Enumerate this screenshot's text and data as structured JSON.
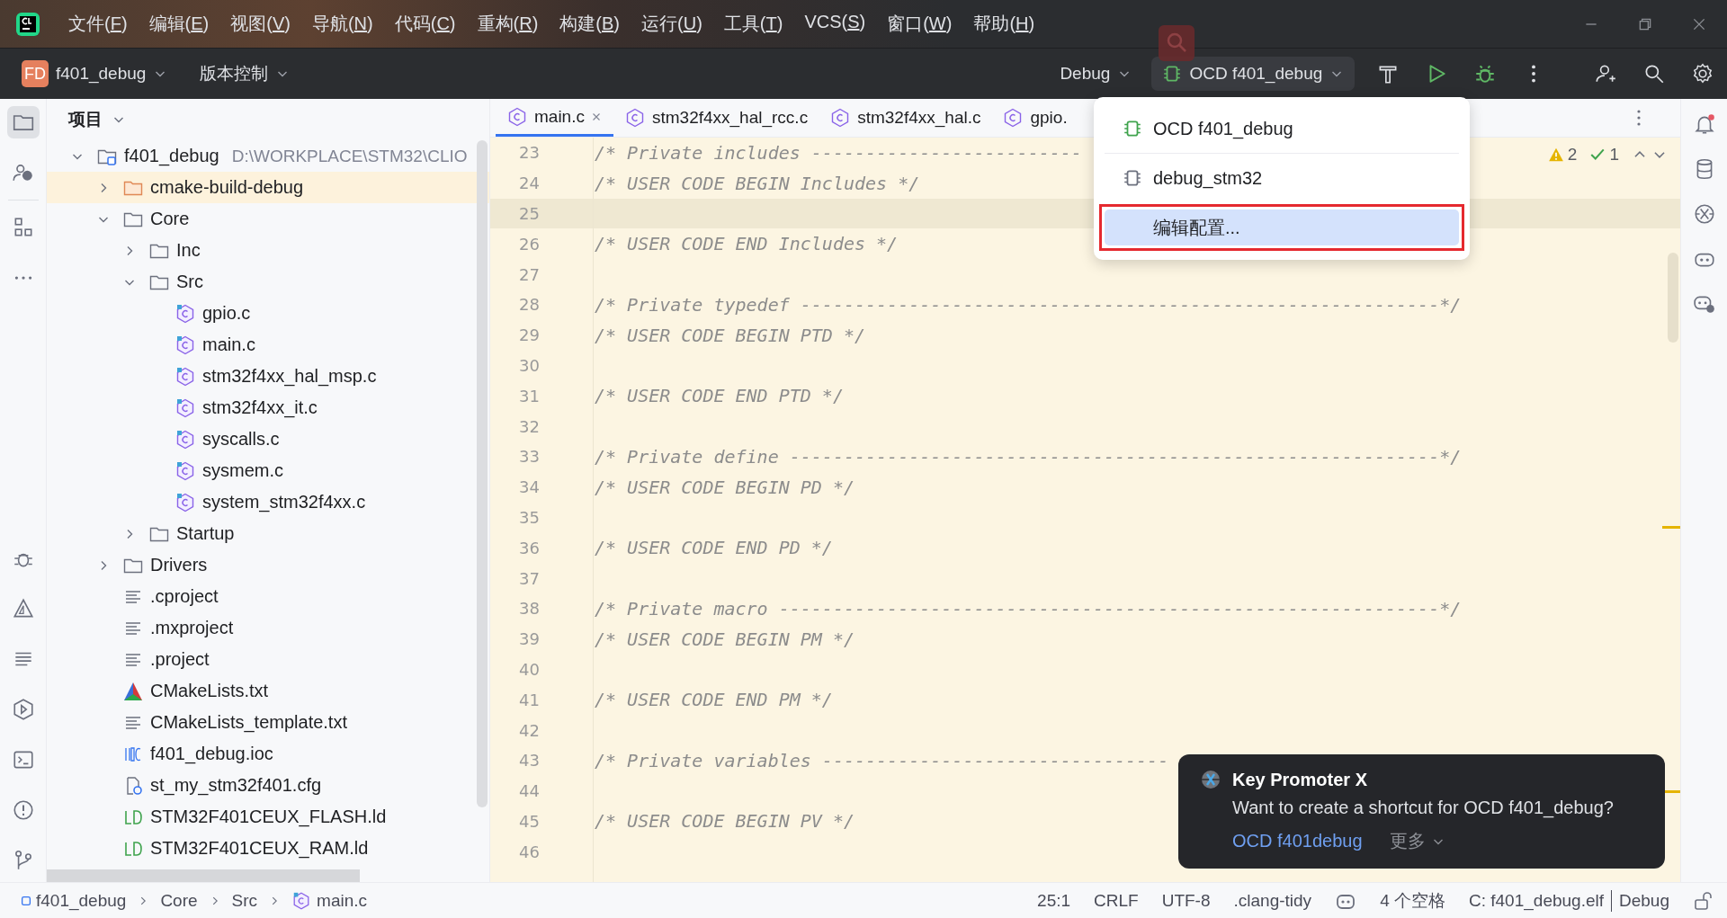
{
  "menu": [
    "文件(F)",
    "编辑(E)",
    "视图(V)",
    "导航(N)",
    "代码(C)",
    "重构(R)",
    "构建(B)",
    "运行(U)",
    "工具(T)",
    "VCS(S)",
    "窗口(W)",
    "帮助(H)"
  ],
  "toolbar": {
    "project_badge": "FD",
    "project": "f401_debug",
    "vcs": "版本控制",
    "build_type": "Debug",
    "run_config": "OCD f401_debug"
  },
  "project_panel": {
    "title": "项目"
  },
  "tree": [
    {
      "name": "f401_debug",
      "path": "D:\\WORKPLACE\\STM32\\CLIO",
      "kind": "module",
      "expanded": true,
      "children": [
        {
          "name": "cmake-build-debug",
          "kind": "folder",
          "expanded": false,
          "excluded": true
        },
        {
          "name": "Core",
          "kind": "folder",
          "expanded": true,
          "excluded": false,
          "children": [
            {
              "name": "Inc",
              "kind": "folder",
              "expanded": false,
              "excluded": false
            },
            {
              "name": "Src",
              "kind": "folder",
              "expanded": true,
              "excluded": false,
              "children": [
                {
                  "name": "gpio.c",
                  "kind": "c"
                },
                {
                  "name": "main.c",
                  "kind": "c"
                },
                {
                  "name": "stm32f4xx_hal_msp.c",
                  "kind": "c"
                },
                {
                  "name": "stm32f4xx_it.c",
                  "kind": "c"
                },
                {
                  "name": "syscalls.c",
                  "kind": "c"
                },
                {
                  "name": "sysmem.c",
                  "kind": "c"
                },
                {
                  "name": "system_stm32f4xx.c",
                  "kind": "c"
                }
              ]
            },
            {
              "name": "Startup",
              "kind": "folder",
              "expanded": false,
              "excluded": false
            }
          ]
        },
        {
          "name": "Drivers",
          "kind": "folder",
          "expanded": false,
          "excluded": false
        },
        {
          "name": ".cproject",
          "kind": "text"
        },
        {
          "name": ".mxproject",
          "kind": "text"
        },
        {
          "name": ".project",
          "kind": "text"
        },
        {
          "name": "CMakeLists.txt",
          "kind": "cmake"
        },
        {
          "name": "CMakeLists_template.txt",
          "kind": "text"
        },
        {
          "name": "f401_debug.ioc",
          "kind": "ioc"
        },
        {
          "name": "st_my_stm32f401.cfg",
          "kind": "cfg"
        },
        {
          "name": "STM32F401CEUX_FLASH.ld",
          "kind": "ld"
        },
        {
          "name": "STM32F401CEUX_RAM.ld",
          "kind": "ld"
        }
      ]
    }
  ],
  "tabs": [
    {
      "label": "main.c",
      "selected": true
    },
    {
      "label": "stm32f4xx_hal_rcc.c",
      "selected": false
    },
    {
      "label": "stm32f4xx_hal.c",
      "selected": false
    },
    {
      "label": "gpio.",
      "selected": false
    }
  ],
  "inspections": {
    "warnings": "2",
    "passed": "1"
  },
  "code": [
    {
      "no": "23",
      "current": false,
      "text": "/* Private includes -------------------------"
    },
    {
      "no": "24",
      "current": false,
      "text": "/* USER CODE BEGIN Includes */"
    },
    {
      "no": "25",
      "current": true
    },
    {
      "no": "26",
      "current": false,
      "text": "/* USER CODE END Includes */"
    },
    {
      "no": "27",
      "current": false
    },
    {
      "no": "28",
      "current": false,
      "text": "/* Private typedef -----------------------------------------------------------*/"
    },
    {
      "no": "29",
      "current": false,
      "text": "/* USER CODE BEGIN PTD */"
    },
    {
      "no": "30",
      "current": false
    },
    {
      "no": "31",
      "current": false,
      "text": "/* USER CODE END PTD */"
    },
    {
      "no": "32",
      "current": false
    },
    {
      "no": "33",
      "current": false,
      "text": "/* Private define ------------------------------------------------------------*/"
    },
    {
      "no": "34",
      "current": false,
      "text": "/* USER CODE BEGIN PD */"
    },
    {
      "no": "35",
      "current": false
    },
    {
      "no": "36",
      "current": false,
      "text": "/* USER CODE END PD */"
    },
    {
      "no": "37",
      "current": false
    },
    {
      "no": "38",
      "current": false,
      "text": "/* Private macro -------------------------------------------------------------*/"
    },
    {
      "no": "39",
      "current": false,
      "text": "/* USER CODE BEGIN PM */"
    },
    {
      "no": "40",
      "current": false
    },
    {
      "no": "41",
      "current": false,
      "text": "/* USER CODE END PM */"
    },
    {
      "no": "42",
      "current": false
    },
    {
      "no": "43",
      "current": false,
      "text": "/* Private variables --------------------------------"
    },
    {
      "no": "44",
      "current": false
    },
    {
      "no": "45",
      "current": false,
      "text": "/* USER CODE BEGIN PV */"
    },
    {
      "no": "46",
      "current": false
    }
  ],
  "run_menu": [
    {
      "label": "OCD f401_debug",
      "kind": "config",
      "active": true,
      "selected": false,
      "marked": false,
      "separator_after": true
    },
    {
      "label": "debug_stm32",
      "kind": "config",
      "active": false,
      "selected": false,
      "marked": false,
      "separator_after": false
    },
    {
      "label": "编辑配置...",
      "kind": "action",
      "selected": true,
      "marked": true,
      "separator_after": false
    }
  ],
  "notification": {
    "title": "Key Promoter X",
    "message": "Want to create a shortcut for OCD f401_debug?",
    "action": "OCD f401debug",
    "more": "更多"
  },
  "breadcrumbs": [
    {
      "label": "f401_debug",
      "kind": "module"
    },
    {
      "label": "Core",
      "kind": "folder"
    },
    {
      "label": "Src",
      "kind": "folder"
    },
    {
      "label": "main.c",
      "kind": "c"
    }
  ],
  "status": {
    "position": "25:1",
    "line_ending": "CRLF",
    "encoding": "UTF-8",
    "linter": ".clang-tidy",
    "indent": "4 个空格",
    "target": "C: f401_debug.elf",
    "config": "Debug"
  }
}
